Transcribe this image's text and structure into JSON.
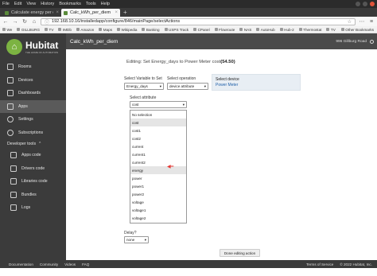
{
  "browser": {
    "menu": [
      "File",
      "Edit",
      "View",
      "History",
      "Bookmarks",
      "Tools",
      "Help"
    ],
    "tabs": [
      {
        "label": "Calculate energy per day",
        "active": false
      },
      {
        "label": "Calc_kWh_per_diem",
        "active": true
      }
    ],
    "url": "192.168.10.16/installedapp/configure/846/mainPage/selectActions",
    "bookmarks": [
      "We",
      "GILLBURG",
      "TV",
      "IMDb",
      "Amazon",
      "Maps",
      "Wikipedia",
      "Banking",
      "USPS Track",
      "CPanel",
      "Flowroute",
      "NAS",
      "AutoHub",
      "Hub-2",
      "Thermostat",
      "TV"
    ],
    "other_bookmarks": "Other Bookmarks"
  },
  "app": {
    "logo": "Hubitat",
    "logo_sub": "THE HOME OF AUTOMATION",
    "page_title": "Calc_kWh_per_diem",
    "location": "996 Gillburg Road",
    "nav": [
      {
        "label": "Rooms",
        "icon": "rooms-icon"
      },
      {
        "label": "Devices",
        "icon": "devices-icon"
      },
      {
        "label": "Dashboards",
        "icon": "dashboards-icon"
      },
      {
        "label": "Apps",
        "icon": "apps-icon",
        "active": true
      },
      {
        "label": "Settings",
        "icon": "settings-icon"
      },
      {
        "label": "Subscriptions",
        "icon": "subscriptions-icon"
      }
    ],
    "dev_tools_label": "Developer tools",
    "dev_nav": [
      {
        "label": "Apps code",
        "icon": "code-icon"
      },
      {
        "label": "Drivers code",
        "icon": "code-icon"
      },
      {
        "label": "Libraries code",
        "icon": "code-icon"
      },
      {
        "label": "Bundles",
        "icon": "bundles-icon"
      },
      {
        "label": "Logs",
        "icon": "logs-icon"
      }
    ]
  },
  "form": {
    "editing_prefix": "Editing: Set Energy_days to Power Meter cost",
    "editing_value": "(54.50)",
    "variable_label": "Select Variable to Set",
    "variable_value": "Energy_days",
    "operation_label": "Select operation",
    "operation_value": "device attribute",
    "device_label": "Select device",
    "device_value": "Power Meter",
    "attribute_label": "Select attribute",
    "attribute_value": "cost",
    "attribute_options": [
      "No selection",
      "cost",
      "cost1",
      "cost2",
      "current",
      "current1",
      "current2",
      "energy",
      "power",
      "power1",
      "power2",
      "voltage",
      "voltage1",
      "voltage2"
    ],
    "highlighted_options": [
      "cost",
      "energy"
    ],
    "delay_label": "Delay?",
    "delay_value": "none",
    "done_button": "Done editing action"
  },
  "footer": {
    "links": [
      "Documentation",
      "Community",
      "Videos",
      "FAQ"
    ],
    "terms": "Terms of Service",
    "copyright": "© 2022 Hubitat, Inc."
  }
}
